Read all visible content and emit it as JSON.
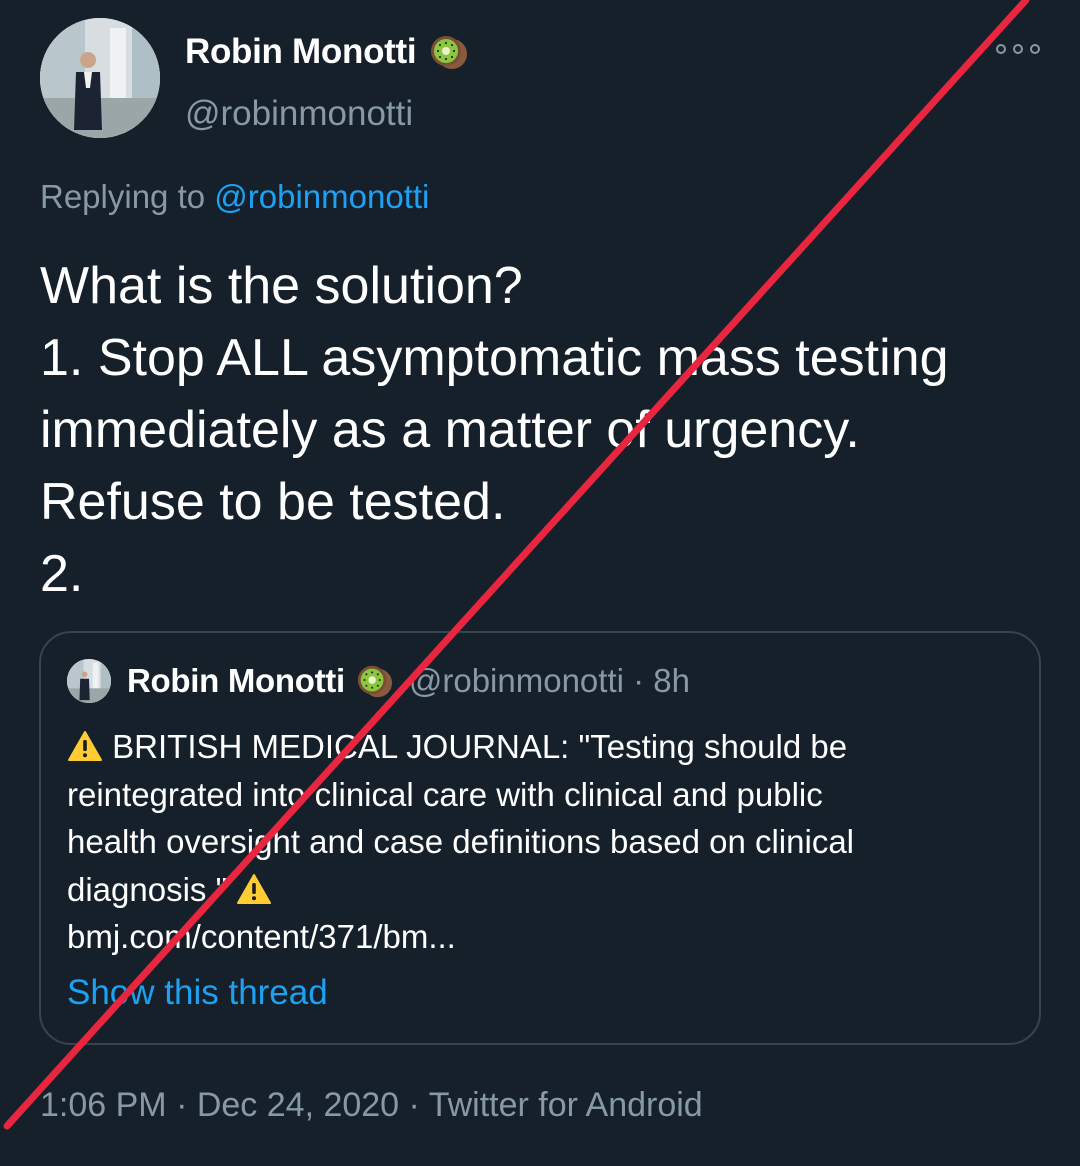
{
  "tweet": {
    "author": {
      "display_name": "Robin Monotti",
      "handle": "@robinmonotti",
      "badge_icon": "kiwi-emoji"
    },
    "more_icon": "more-options-icon",
    "reply_prefix": "Replying to",
    "reply_to": "@robinmonotti",
    "text_lines": [
      "What is the solution?",
      "1. Stop ALL asymptomatic mass testing",
      "immediately as a matter of urgency.",
      "Refuse to be tested.",
      "2."
    ],
    "quoted_tweet": {
      "display_name": "Robin Monotti",
      "handle_time": "@robinmonotti · 8h",
      "badge_icon": "kiwi-emoji",
      "warning_icon": "warning-sign-emoji",
      "lines": [
        "BRITISH MEDICAL JOURNAL: \"Testing should be",
        "reintegrated into clinical care with clinical and public",
        "health oversight and case definitions based on clinical",
        "diagnosis.\"",
        "bmj.com/content/371/bm..."
      ],
      "show_thread": "Show this thread"
    },
    "timestamp": "1:06 PM · Dec 24, 2020 · ",
    "source": "Twitter for Android"
  },
  "colors": {
    "background": "#15202b",
    "primary_text": "#ffffff",
    "secondary_text": "#8899a6",
    "link": "#1da1f2",
    "border": "#38444d",
    "strike_line": "#e8263f"
  }
}
